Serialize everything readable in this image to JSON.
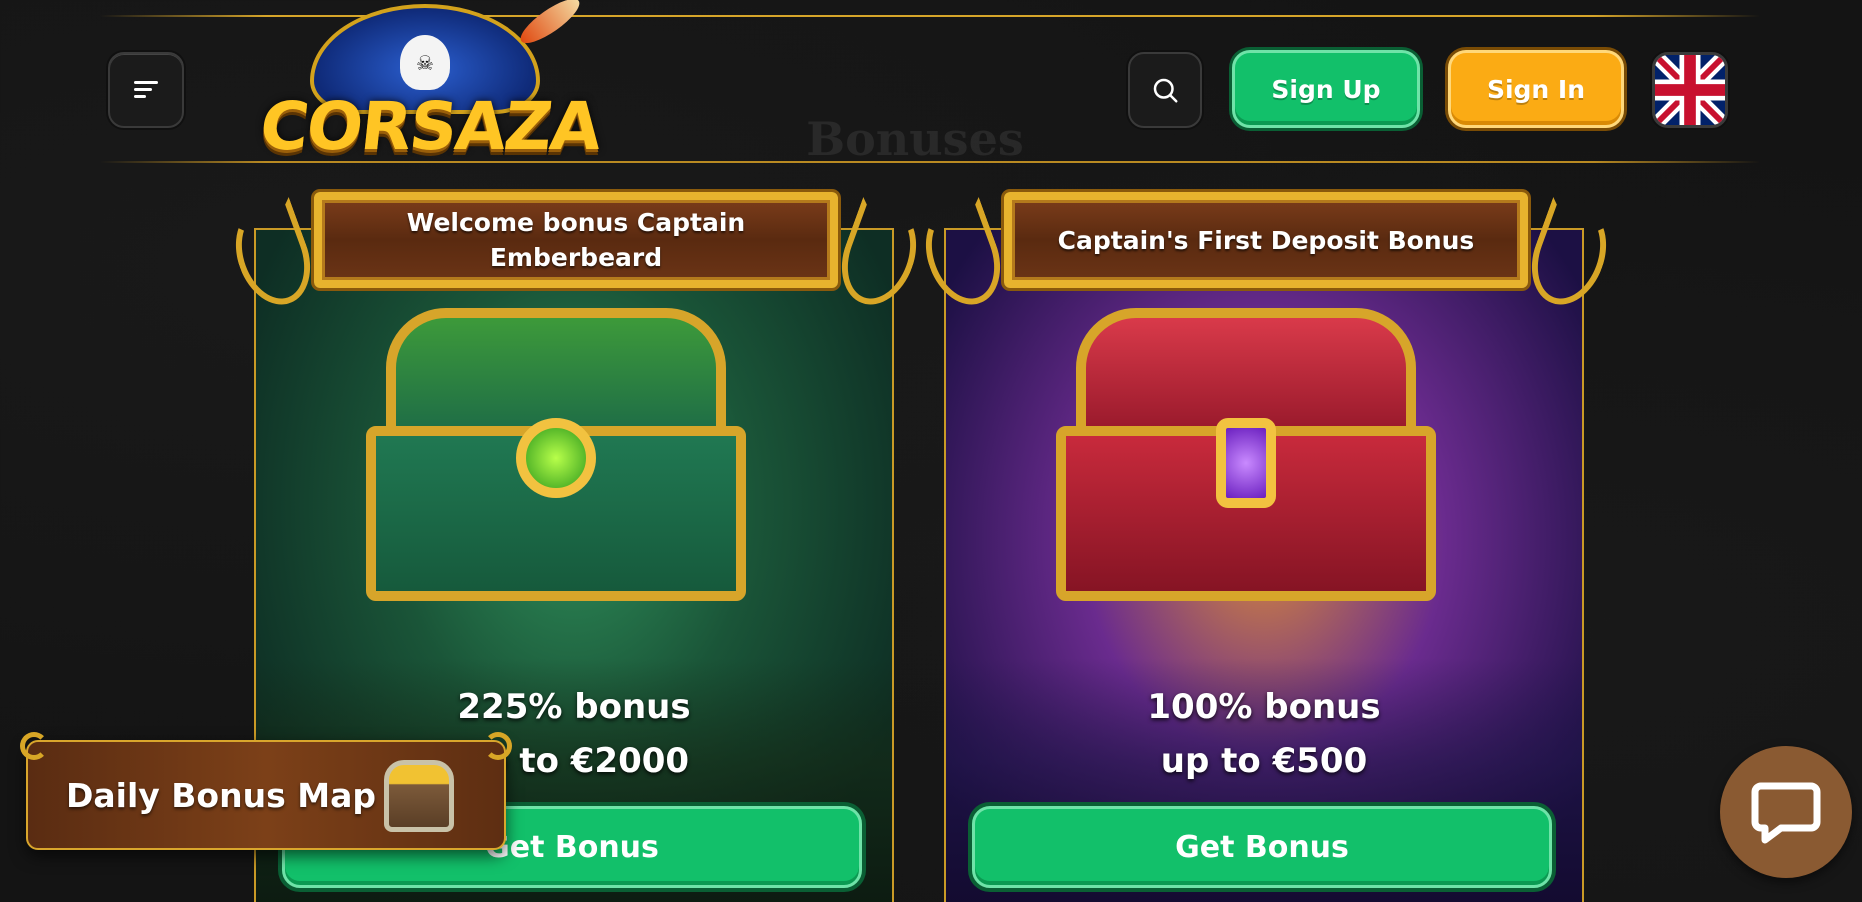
{
  "header": {
    "menu_icon": "hamburger-menu-icon",
    "logo_text": "CORSAZA",
    "page_title": "Bonuses",
    "search_icon": "search-icon",
    "sign_up_label": "Sign Up",
    "sign_in_label": "Sign In",
    "language_flag": "uk-flag-icon"
  },
  "bonuses": [
    {
      "title": "Welcome bonus Captain Emberbeard",
      "offer_line1": "225% bonus",
      "offer_line2": "up to €2000",
      "button_label": "Get Bonus"
    },
    {
      "title": "Captain's First Deposit Bonus",
      "offer_line1": "100% bonus",
      "offer_line2": "up to €500",
      "button_label": "Get Bonus"
    }
  ],
  "daily_bonus": {
    "label": "Daily Bonus Map"
  },
  "chat": {
    "icon": "chat-bubble-icon"
  },
  "colors": {
    "background": "#141414",
    "sign_up": "#12c06a",
    "sign_in": "#fbab14",
    "gold": "#d6a52a",
    "chat": "#8a5a32"
  }
}
